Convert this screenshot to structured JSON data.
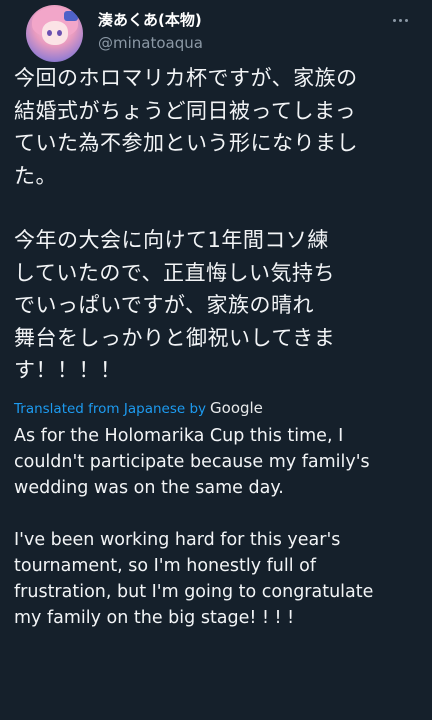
{
  "author": {
    "display_name": "湊あくあ(本物)",
    "handle": "@minatoaqua"
  },
  "tweet": {
    "jp_paragraph_1": [
      "今回のホロマリカ杯ですが、家族の",
      "結婚式がちょうど同日被ってしまっ",
      "ていた為不参加という形になりまし",
      "た。"
    ],
    "jp_paragraph_2": [
      "今年の大会に向けて1年間コソ練",
      "していたので、正直悔しい気持ち",
      "でいっぱいですが、家族の晴れ",
      "舞台をしっかりと御祝いしてきま",
      "す！！！！"
    ]
  },
  "translation": {
    "label": "Translated from Japanese by",
    "provider": "Google",
    "en_paragraph_1": [
      "As for the Holomarika Cup this time, I",
      "couldn't participate because my family's",
      "wedding was on the same day."
    ],
    "en_paragraph_2": [
      "I've been working hard for this year's",
      "tournament, so I'm honestly full of",
      "frustration, but I'm going to congratulate",
      "my family on the big stage! ! ! !"
    ]
  },
  "icons": {
    "more": "more-dots-icon"
  },
  "colors": {
    "background": "#15202b",
    "text": "#f2f4f6",
    "secondary": "#8b98a5",
    "link": "#1d9bf0"
  }
}
